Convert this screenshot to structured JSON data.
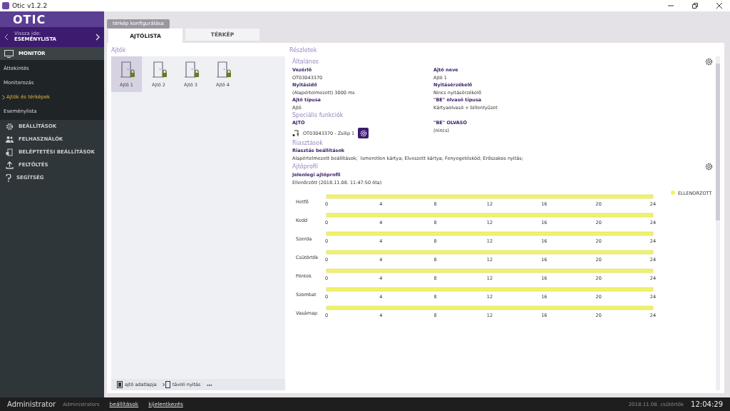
{
  "window": {
    "title": "Otic v1.2.2"
  },
  "sidebar": {
    "logo": "OTIC",
    "back": {
      "label": "Vissza ide:",
      "target": "ESEMÉNYLISTA"
    },
    "sections": [
      {
        "label": "MONITOR",
        "kind": "monitor",
        "expanded": true,
        "children": [
          {
            "label": "Áttekintés",
            "selected": false
          },
          {
            "label": "Monitorozás",
            "selected": false
          },
          {
            "label": "Ajtók és térképek",
            "selected": true
          },
          {
            "label": "Eseménylista",
            "selected": false
          }
        ]
      },
      {
        "label": "BEÁLLÍTÁSOK",
        "kind": "gear",
        "expanded": false
      },
      {
        "label": "FELHASZNÁLÓK",
        "kind": "users",
        "expanded": false
      },
      {
        "label": "BELÉPTETÉSI BEÁLLÍTÁSOK",
        "kind": "access",
        "expanded": false
      },
      {
        "label": "FELTÖLTÉS",
        "kind": "upload",
        "expanded": false
      },
      {
        "label": "SEGÍTSÉG",
        "kind": "help",
        "expanded": false
      }
    ]
  },
  "toolbar": {
    "button": "térkép konfigurálása"
  },
  "tabs": [
    {
      "label": "AJTÓLISTA",
      "selected": true
    },
    {
      "label": "TÉRKÉP",
      "selected": false
    }
  ],
  "doors": {
    "title": "Ajtók",
    "items": [
      {
        "label": "Ajtó 1",
        "selected": true,
        "locked": true
      },
      {
        "label": "Ajtó 2",
        "selected": false,
        "locked": true
      },
      {
        "label": "Ajtó 3",
        "selected": false,
        "locked": true
      },
      {
        "label": "Ajtó 4",
        "selected": false,
        "locked": true
      }
    ],
    "actions": [
      {
        "label": "ajtó adatlapja",
        "kind": "sheet"
      },
      {
        "label": "távoli nyitás",
        "kind": "remote"
      },
      {
        "label": "•••",
        "kind": "more"
      }
    ]
  },
  "details": {
    "title": "Részletek",
    "general": {
      "title": "Általános",
      "fields": [
        {
          "label": "Vezérlő",
          "value": "OT03043370"
        },
        {
          "label": "Ajtó neve",
          "value": "Ajtó 1"
        },
        {
          "label": "Nyitásidő",
          "value": "(Alapértelmezett) 3000 ms"
        },
        {
          "label": "Nyitásérzékelő",
          "value": "Nincs nyitásérzékelő"
        },
        {
          "label": "Ajtó típusa",
          "value": "Ajtó"
        },
        {
          "label": "\"BE\" olvasó típusa",
          "value": "Kártyaolvasó + billentyűzet"
        }
      ]
    },
    "special": {
      "title": "Speciális funkciók",
      "door": {
        "label": "AJTÓ",
        "value": "OT03043370 - Zsilip 1"
      },
      "reader": {
        "label": "\"BE\" OLVASÓ",
        "value": "(nincs)"
      }
    },
    "alarms": {
      "title": "Riasztások",
      "label": "Riasztás beállítások",
      "value": "Alapértelmezett beállítások;  Ismeretlen kártya; Elveszett kártya; Fenyegetéskód; Erőszakos nyitás;"
    },
    "profile": {
      "title": "Ajtóprofil",
      "label": "Jelenlegi ajtóprofil",
      "value": "Ellenőrzött (2018.11.08. 11:47:50 óta)",
      "legend": [
        {
          "label": "ELLENORZOTT",
          "color": "#f2f26a"
        }
      ],
      "days": [
        {
          "day": "Hetfő",
          "level": 1,
          "ticks": [
            "0",
            "4",
            "8",
            "12",
            "16",
            "20",
            "24"
          ]
        },
        {
          "day": "Kedd",
          "level": 1,
          "ticks": [
            "0",
            "4",
            "8",
            "12",
            "16",
            "20",
            "24"
          ]
        },
        {
          "day": "Szerda",
          "level": 1,
          "ticks": [
            "0",
            "4",
            "8",
            "12",
            "16",
            "20",
            "24"
          ]
        },
        {
          "day": "Csütörtök",
          "level": 1,
          "ticks": [
            "0",
            "4",
            "8",
            "12",
            "16",
            "20",
            "24"
          ]
        },
        {
          "day": "Péntek",
          "level": 1,
          "ticks": [
            "0",
            "4",
            "8",
            "12",
            "16",
            "20",
            "24"
          ]
        },
        {
          "day": "Szombat",
          "level": 1,
          "ticks": [
            "0",
            "4",
            "8",
            "12",
            "16",
            "20",
            "24"
          ]
        },
        {
          "day": "Vasárnap",
          "level": 1,
          "ticks": [
            "0",
            "4",
            "8",
            "12",
            "16",
            "20",
            "24"
          ]
        }
      ]
    }
  },
  "status_bar": {
    "user": "Administrator",
    "group": "Administrators",
    "links": [
      "beállítások",
      "kijelentkezés"
    ],
    "date": "2018.11.08. csütörtök",
    "time": "12:04:29"
  }
}
